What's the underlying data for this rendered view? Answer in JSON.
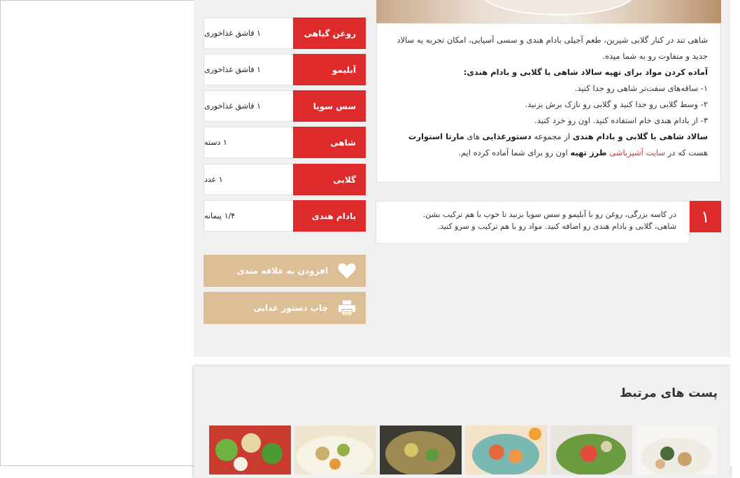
{
  "ingredients": [
    {
      "name": "روغن گیاهی",
      "qty": "۱ قاشق غذاخوری"
    },
    {
      "name": "آبلیمو",
      "qty": "۱ قاشق غذاخوری"
    },
    {
      "name": "سس سویا",
      "qty": "۱ قاشق غذاخوری"
    },
    {
      "name": "شاهی",
      "qty": "۱ دسته"
    },
    {
      "name": "گلابی",
      "qty": "۱ عدد"
    },
    {
      "name": "بادام هندی",
      "qty": "۱/۴ پیمانه"
    }
  ],
  "actions": {
    "favorite_label": "افزودن به علاقه مندی",
    "print_label": "چاپ دستور غذایی"
  },
  "intro": {
    "para1": "شاهی تند در کنار گلابی شیرین، طعم آجیلی بادام هندی و سسی آسیایی، امکان تجربه یه سالاد جدید و متفاوت رو به شما میده.",
    "prep_heading": "آماده کردن مواد برای تهیه سالاد شاهی با گلابی و بادام هندی:",
    "steps": [
      "۱- ساقه‌های سفت‌تر شاهی رو جدا کنید.",
      "۲- وسط گلابی رو جدا کنید و گلابی رو نازک برش بزنید.",
      "۳- از بادام هندی خام استفاده کنید. اون رو خرد کنید."
    ],
    "closing_bold1": "سالاد شاهی با گلابی و بادام هندی",
    "closing_t1": " از مجموعه ",
    "closing_bold2": "دستورغذایی",
    "closing_t2": " های ",
    "closing_bold3": "مارتا استوارت",
    "closing_t3": " هست که در ",
    "closing_link": "سایت آشپزباشی",
    "closing_t4": " ",
    "closing_bold4": "طرز تهیه",
    "closing_t5": " اون رو برای شما آماده کرده ایم."
  },
  "step1": {
    "number": "۱",
    "line1": "در کاسه بزرگی، روغن رو با آبلیمو و سس سویا بزنید تا خوب با هم ترکیب بشن.",
    "line2": "شاهی، گلابی و بادام هندی رو اضافه کنید. مواد رو با هم ترکیب و سرو کنید."
  },
  "related": {
    "title": "پست های مرتبط"
  },
  "colors": {
    "accent_red": "#dd2b2b",
    "button_tan": "#dcbf97",
    "panel_bg": "#f0f0f0"
  }
}
